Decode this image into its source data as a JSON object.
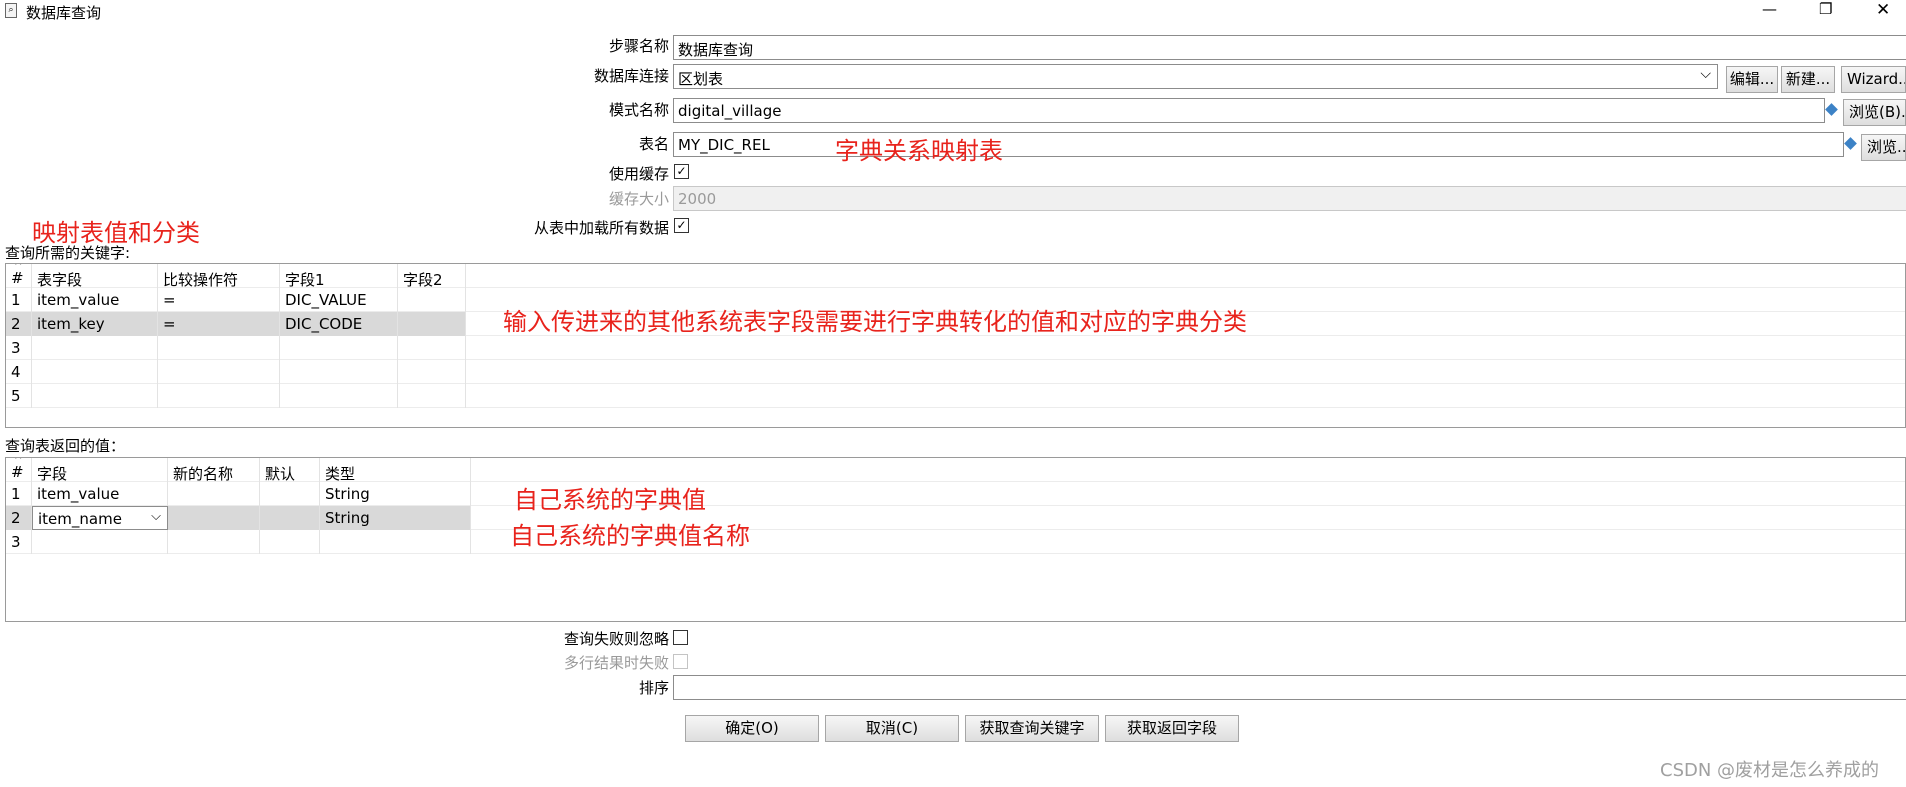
{
  "window": {
    "title": "数据库查询",
    "minimize_glyph": "—",
    "maximize_glyph": "❐",
    "close_glyph": "✕"
  },
  "form": {
    "step_name_label": "步骤名称",
    "step_name_value": "数据库查询",
    "connection_label": "数据库连接",
    "connection_value": "区划表",
    "edit_button": "编辑...",
    "new_button": "新建...",
    "wizard_button": "Wizard...",
    "schema_label": "模式名称",
    "schema_value": "digital_village",
    "browse_b_button": "浏览(B)...",
    "table_label": "表名",
    "table_value": "MY_DIC_REL",
    "browse_button": "浏览...",
    "use_cache_label": "使用缓存",
    "use_cache_checked": true,
    "cache_size_label": "缓存大小",
    "cache_size_value": "2000",
    "load_all_label": "从表中加载所有数据",
    "load_all_checked": true
  },
  "keys_section": {
    "label": "查询所需的关键字:",
    "columns": [
      "#",
      "表字段",
      "比较操作符",
      "字段1",
      "字段2"
    ],
    "rows": [
      [
        "1",
        "item_value",
        "=",
        "DIC_VALUE",
        ""
      ],
      [
        "2",
        "item_key",
        "=",
        "DIC_CODE",
        ""
      ],
      [
        "3",
        "",
        "",
        "",
        ""
      ],
      [
        "4",
        "",
        "",
        "",
        ""
      ],
      [
        "5",
        "",
        "",
        "",
        ""
      ]
    ]
  },
  "return_section": {
    "label": "查询表返回的值：",
    "columns": [
      "#",
      "字段",
      "新的名称",
      "默认",
      "类型"
    ],
    "rows": [
      [
        "1",
        "item_value",
        "",
        "",
        "String"
      ],
      [
        "2",
        "item_name",
        "",
        "",
        "String"
      ],
      [
        "3",
        "",
        "",
        "",
        ""
      ]
    ]
  },
  "options": {
    "ignore_fail_label": "查询失败则忽略",
    "ignore_fail_checked": false,
    "multi_fail_label": "多行结果时失败",
    "multi_fail_checked": false,
    "order_label": "排序",
    "order_value": ""
  },
  "buttons": {
    "ok": "确定(O)",
    "cancel": "取消(C)",
    "get_keys": "获取查询关键字",
    "get_return": "获取返回字段"
  },
  "annotations": {
    "table_note": "字典关系映射表",
    "mapping_note": "映射表值和分类",
    "input_note": "输入传进来的其他系统表字段需要进行字典转化的值和对应的字典分类",
    "dict_value_note": "自己系统的字典值",
    "dict_name_note": "自己系统的字典值名称"
  },
  "watermark": "CSDN @废材是怎么养成的"
}
